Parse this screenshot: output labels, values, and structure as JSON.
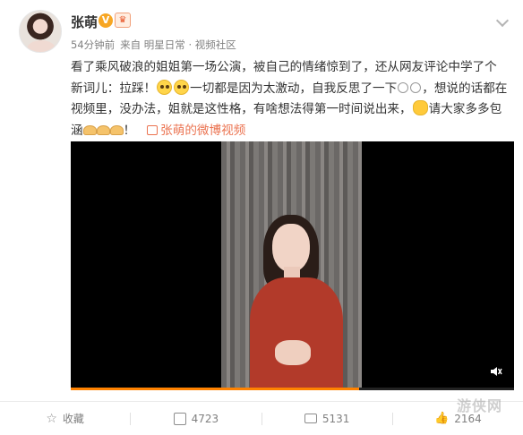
{
  "header": {
    "username": "张萌",
    "verified_badge": "V",
    "member_badge_icon": "crown-icon",
    "time_ago": "54分钟前",
    "source": "来自 明星日常 · 视频社区"
  },
  "content": {
    "line1": "看了乘风破浪的姐姐第一场公演，被自己的情绪惊到了，还从网友评论中学了个",
    "line2_a": "新词儿：拉踩！",
    "line2_b": "一切都是因为太激动，自我反思了一下",
    "line2_c": "，想说的话都在",
    "line3_a": "视频里，没办法，姐就是这性格，有啥想法得第一时间说出来，",
    "line3_b": "请大家多多包",
    "line4_a": "涵",
    "line4_b": "！",
    "video_link": "张萌的微博视频"
  },
  "video": {
    "progress": 0.65,
    "mute_icon": "mute-icon"
  },
  "actions": {
    "favorite_label": "收藏",
    "share_count": "4723",
    "comment_count": "5131",
    "like_count": "2164"
  },
  "watermark": "游侠网"
}
